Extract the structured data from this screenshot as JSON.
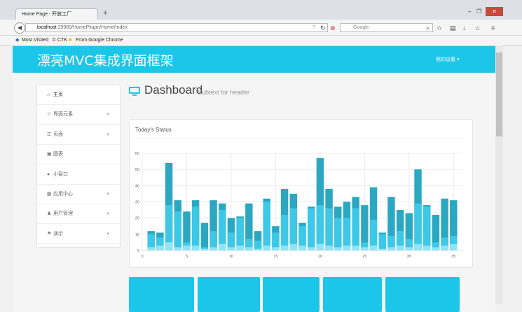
{
  "browser": {
    "tab_title": "Home Page - 开放工厂iOpenWorks",
    "new_tab": "+",
    "url_host": "localhost",
    "url_rest": ":29980/HomePlugin/Home/Index",
    "search_placeholder": "Google",
    "bookmarks": [
      {
        "label": "Most Visited"
      },
      {
        "label": "CTK"
      },
      {
        "label": "From Google Chrome"
      }
    ]
  },
  "app": {
    "brand": "漂亮MVC集成界面框架",
    "settings": "我的设置",
    "accent": "#1cc6e8"
  },
  "sidebar": {
    "items": [
      {
        "label": "主页",
        "icon": "home-icon",
        "caret": false
      },
      {
        "label": "界面元素",
        "icon": "sitemap-icon",
        "caret": true
      },
      {
        "label": "页面",
        "icon": "list-icon",
        "caret": true
      },
      {
        "label": "图表",
        "icon": "picture-icon",
        "caret": false
      },
      {
        "label": "小窗口",
        "icon": "comment-icon",
        "caret": false
      },
      {
        "label": "应用中心",
        "icon": "grid-icon",
        "caret": true
      },
      {
        "label": "用户管理",
        "icon": "user-icon",
        "caret": true
      },
      {
        "label": "演示",
        "icon": "flag-icon",
        "caret": true
      }
    ]
  },
  "page": {
    "title": "Dashboard",
    "subtitle": "Subtext for header"
  },
  "status_card": {
    "title": "Today's Status"
  },
  "chart_data": {
    "type": "bar",
    "x": [
      1,
      2,
      3,
      4,
      5,
      6,
      7,
      8,
      9,
      10,
      11,
      12,
      13,
      14,
      15,
      16,
      17,
      18,
      19,
      20,
      21,
      22,
      23,
      24,
      25,
      26,
      27,
      28,
      29,
      30,
      31,
      32,
      33,
      34,
      35
    ],
    "series": [
      {
        "values": [
          12,
          11,
          54,
          31,
          24,
          31,
          17,
          31,
          29,
          20,
          21,
          29,
          12,
          32,
          15,
          38,
          35,
          17,
          27,
          57,
          38,
          27,
          30,
          33,
          28,
          39,
          11,
          33,
          25,
          23,
          50,
          28,
          22,
          32,
          31
        ]
      },
      {
        "values": [
          10,
          8,
          28,
          24,
          5,
          27,
          2,
          12,
          25,
          11,
          20,
          7,
          6,
          30,
          11,
          22,
          26,
          15,
          26,
          28,
          26,
          20,
          20,
          26,
          5,
          19,
          10,
          9,
          12,
          7,
          29,
          27,
          5,
          8,
          9
        ]
      },
      {
        "values": [
          2,
          3,
          5,
          2,
          3,
          3,
          1,
          2,
          4,
          2,
          3,
          2,
          1,
          3,
          2,
          3,
          4,
          3,
          2,
          4,
          3,
          2,
          3,
          3,
          2,
          3,
          1,
          2,
          3,
          2,
          4,
          3,
          2,
          3,
          4
        ]
      }
    ],
    "xticks": [
      0,
      5,
      10,
      15,
      20,
      25,
      30,
      35
    ],
    "yticks": [
      0,
      10,
      20,
      30,
      40,
      50,
      60
    ],
    "xlim": [
      0,
      36
    ],
    "ylim": [
      0,
      60
    ],
    "grid": true,
    "colors": [
      "#2aa8c1",
      "#3cc8e6",
      "#8fe4f6"
    ]
  }
}
